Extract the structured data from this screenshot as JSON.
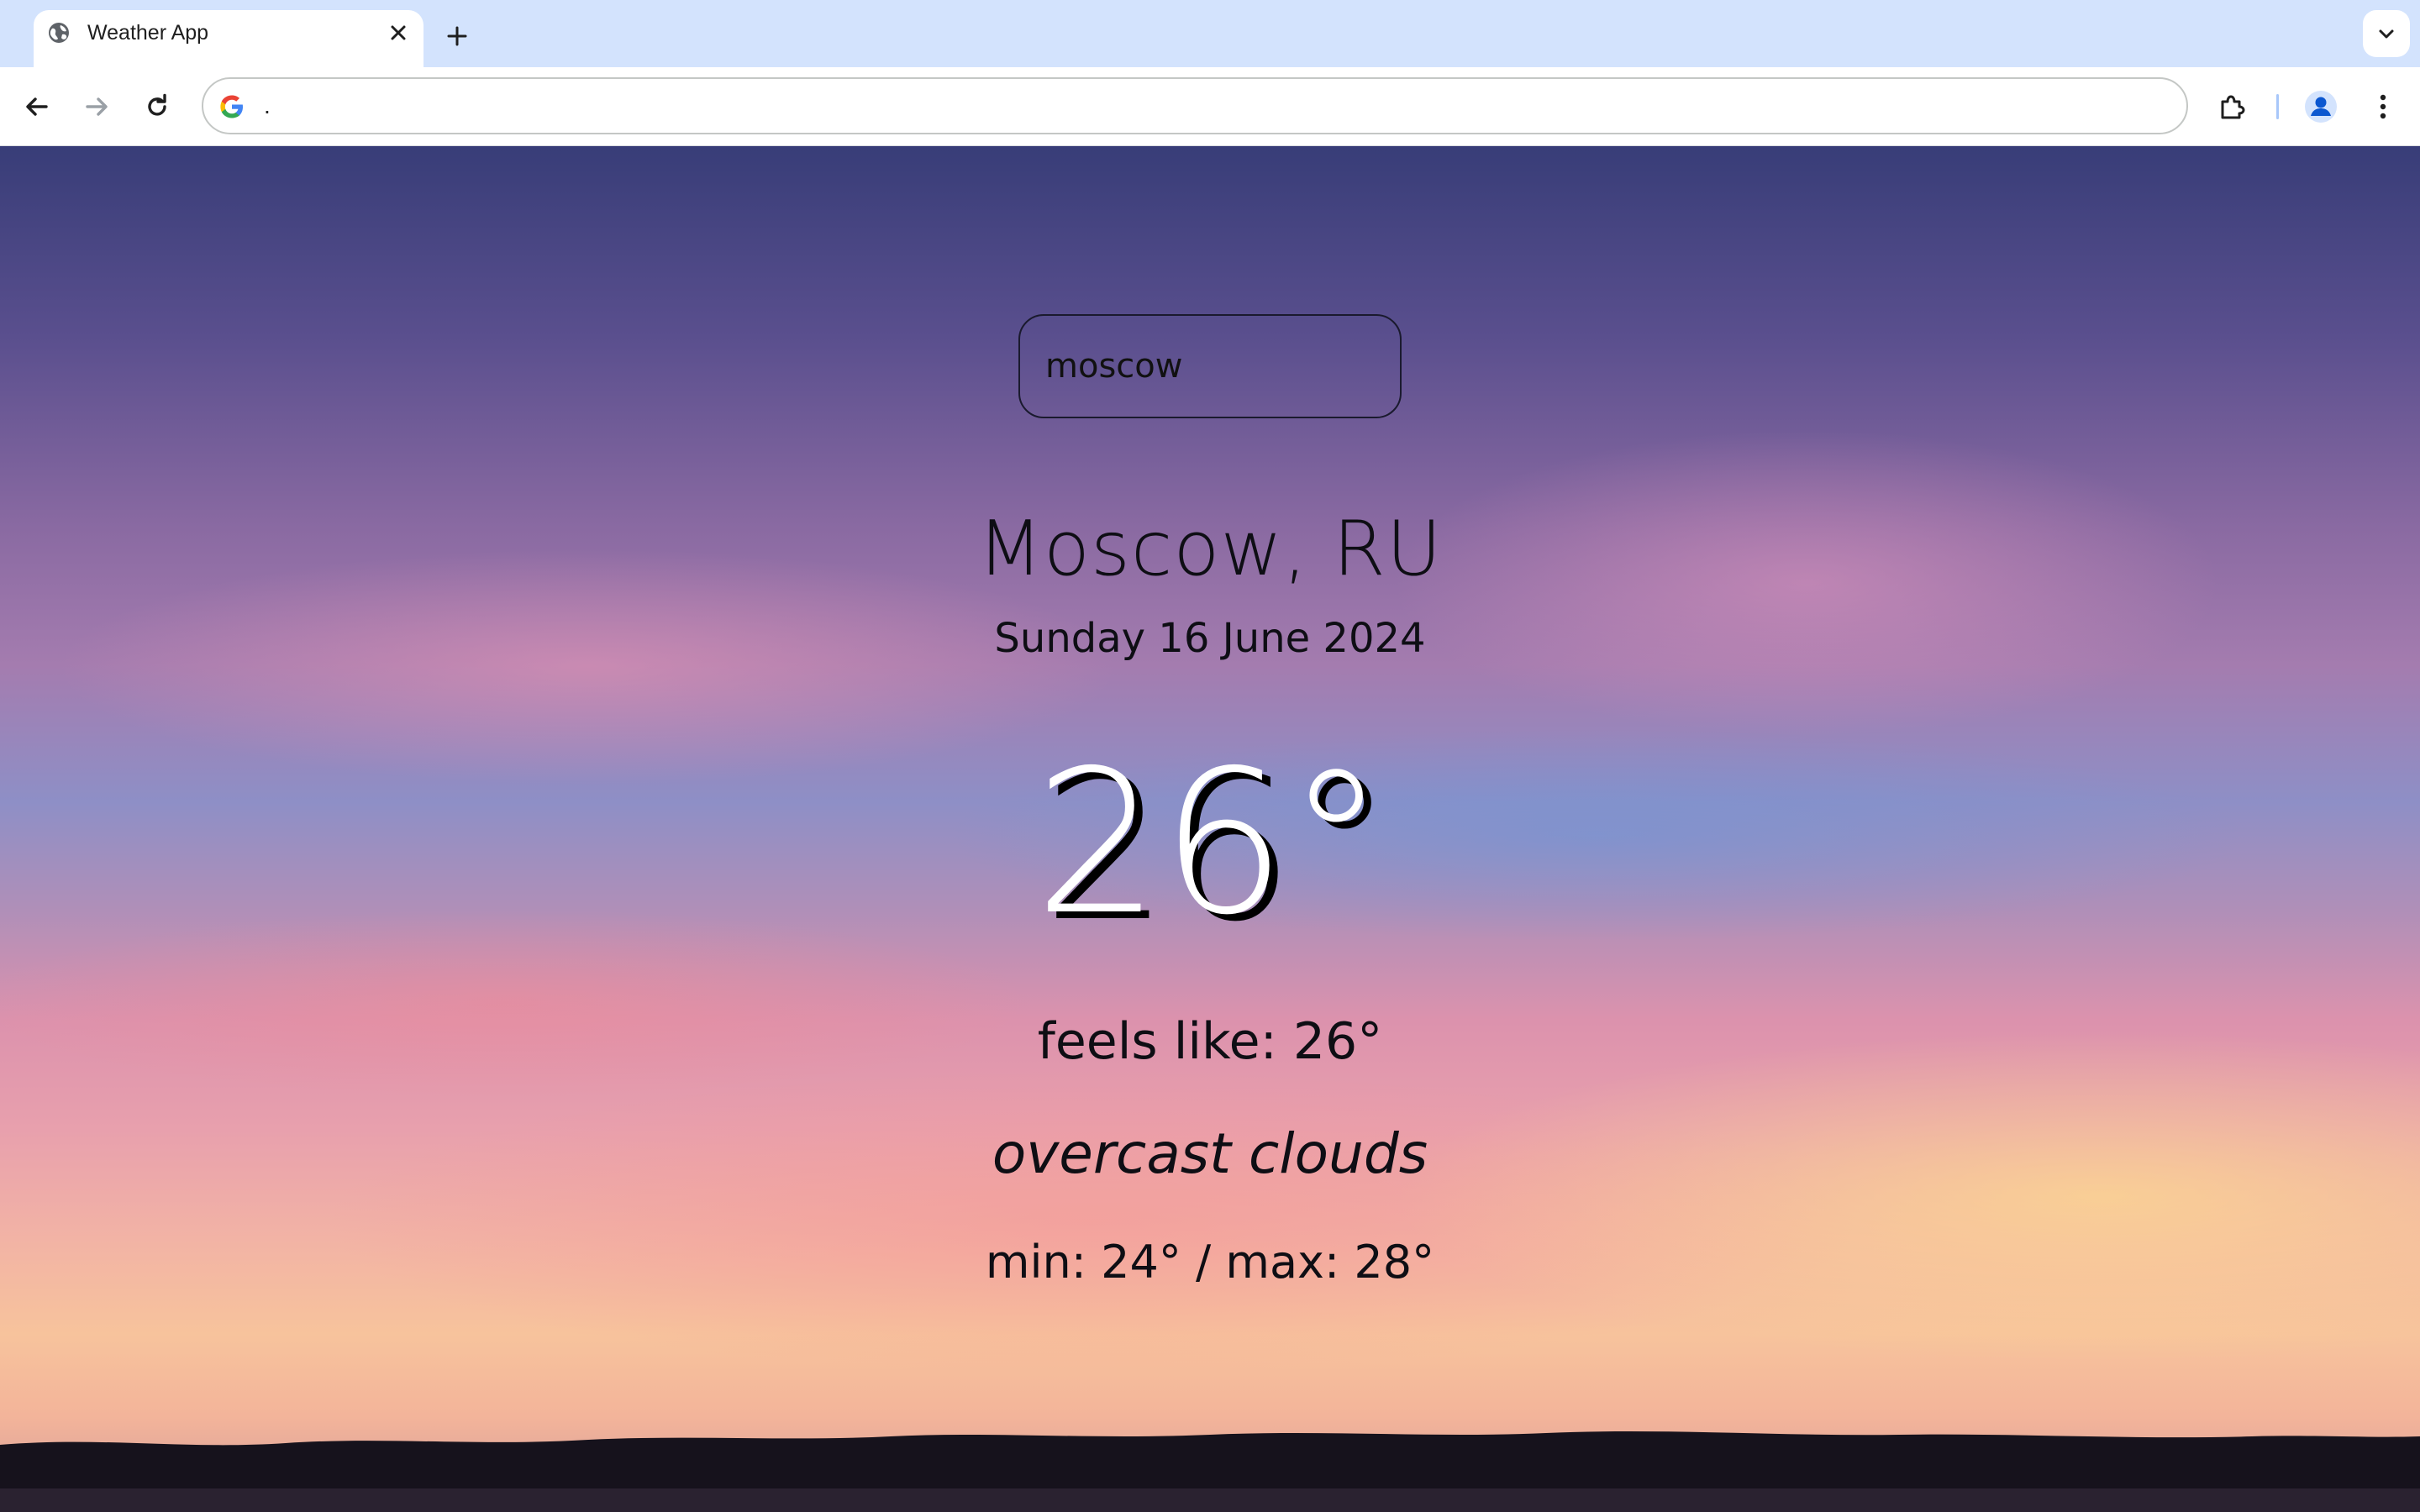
{
  "browser": {
    "tab_title": "Weather App",
    "address_text": "."
  },
  "icons": {
    "tab_favicon": "globe-icon",
    "tab_close": "close-icon",
    "new_tab": "plus-icon",
    "tab_search": "chevron-down-icon",
    "back": "arrow-left-icon",
    "forward": "arrow-right-icon",
    "reload": "reload-icon",
    "omnibox": "google-g-icon",
    "extensions": "puzzle-icon",
    "profile": "profile-avatar-icon",
    "menu": "kebab-menu-icon"
  },
  "weather": {
    "search_value": "moscow",
    "city": "Moscow, RU",
    "date": "Sunday 16 June 2024",
    "temperature": "26°",
    "feels_like": "feels like: 26°",
    "description": "overcast clouds",
    "min_max": "min: 24° / max: 28°"
  },
  "colors": {
    "tabbar_bg": "#d3e3fd",
    "profile_blue": "#0b57d0",
    "text_dark": "#0e0e14",
    "temperature_text": "#ffffff"
  }
}
